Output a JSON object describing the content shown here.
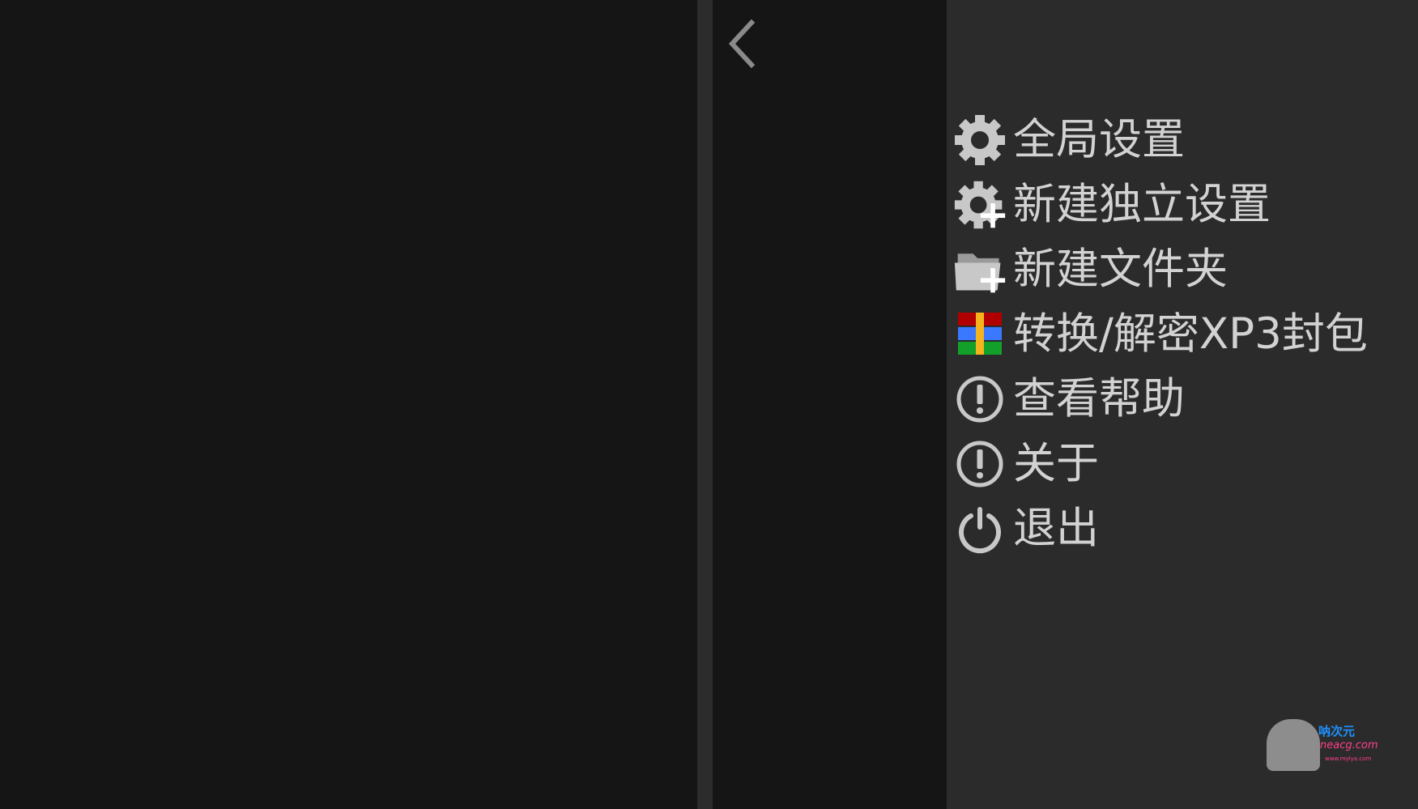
{
  "navigation": {
    "back_icon": "chevron-left-icon"
  },
  "menu": {
    "items": [
      {
        "id": "global-settings",
        "label": "全局设置",
        "icon": "gear-icon"
      },
      {
        "id": "new-independent-settings",
        "label": "新建独立设置",
        "icon": "gear-plus-icon"
      },
      {
        "id": "new-folder",
        "label": "新建文件夹",
        "icon": "folder-plus-icon"
      },
      {
        "id": "convert-decrypt-xp3",
        "label": "转换/解密XP3封包",
        "icon": "archive-icon"
      },
      {
        "id": "view-help",
        "label": "查看帮助",
        "icon": "exclamation-circle-icon"
      },
      {
        "id": "about",
        "label": "关于",
        "icon": "exclamation-circle-icon"
      },
      {
        "id": "exit",
        "label": "退出",
        "icon": "power-icon"
      }
    ]
  },
  "watermark": {
    "name": "呐次元",
    "domain": "neacg.com",
    "url": "www.mylya.com"
  },
  "colors": {
    "background": "#151515",
    "divider": "#2c2c2c",
    "drawer": "#2b2b2b",
    "menu_text": "#d2d2d2",
    "icon": "#c8c8c8"
  }
}
